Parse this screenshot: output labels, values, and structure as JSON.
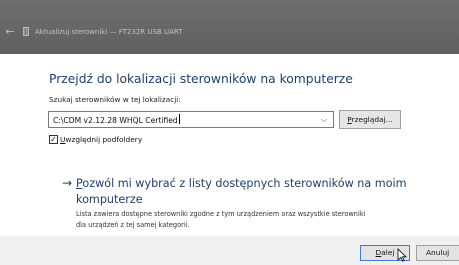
{
  "window": {
    "title": "Aktualizuj sterowniki — FT232R USB UART",
    "back_icon": "back-arrow-icon",
    "app_icon": "device-icon"
  },
  "main": {
    "heading": "Przejdź do lokalizacji sterowników na komputerze",
    "search_label": "Szukaj sterowników w tej lokalizacji:",
    "path_value": "C:\\CDM v2.12.28 WHQL Certified",
    "dropdown_icon": "chevron-down-icon",
    "browse_label_first": "P",
    "browse_label_rest": "rzeglądaj...",
    "include_subfolders": {
      "checked": true,
      "label_first": "U",
      "label_rest": "względnij podfoldery"
    },
    "option": {
      "arrow": "→",
      "title_first": "P",
      "title_line1_rest": "ozwól mi wybrać z listy dostępnych sterowników na moim",
      "title_line2": "komputerze",
      "desc_line1": "Lista zawiera dostępne sterowniki zgodne z tym urządzeniem oraz wszystkie sterowniki",
      "desc_line2": "dla urządzeń z tej samej kategorii."
    }
  },
  "footer": {
    "next_first": "D",
    "next_rest": "alej",
    "cancel_label": "Anuluj",
    "cursor_icon": "mouse-pointer-icon"
  },
  "colors": {
    "titlebar": "#666666",
    "heading": "#1f3f6a",
    "footer": "#f0f0f0",
    "focus_border": "#3c7fd1"
  }
}
